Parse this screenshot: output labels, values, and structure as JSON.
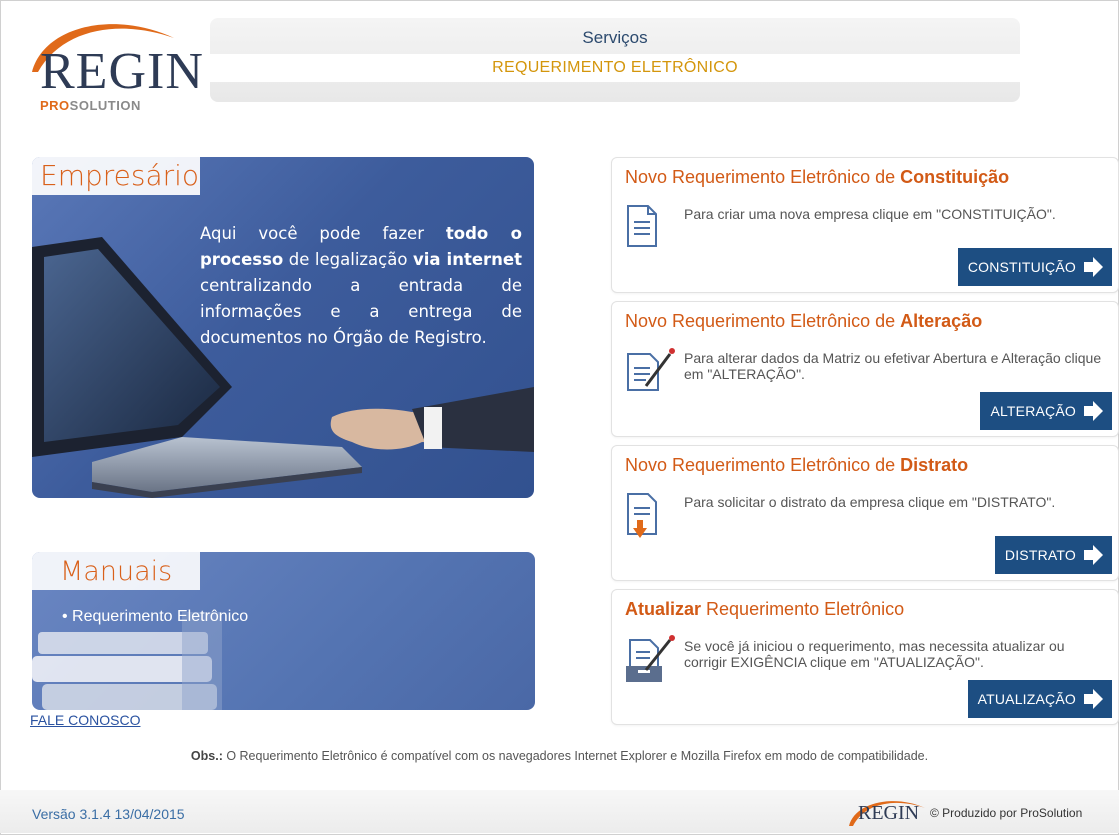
{
  "logo": {
    "name": "REGIN",
    "sub_pro": "PRO",
    "sub_solution": "SOLUTION"
  },
  "header": {
    "title": "Serviços",
    "subtitle": "REQUERIMENTO ELETRÔNICO"
  },
  "empresario": {
    "title": "Empresário",
    "text_1": "Aqui você pode fazer ",
    "text_b1": "todo o processo",
    "text_2": " de legalização ",
    "text_b2": "via internet",
    "text_3": " centralizando a entrada de informações e a entrega de documentos no Órgão de Registro."
  },
  "manuais": {
    "title": "Manuais",
    "link": "• Requerimento Eletrônico"
  },
  "fale_conosco": "FALE CONOSCO",
  "cards": [
    {
      "title_pre": "Novo Requerimento Eletrônico de ",
      "title_bold": "Constituição",
      "title_post": "",
      "desc": "Para criar uma nova empresa clique em \"CONSTITUIÇÃO\".",
      "button": "CONSTITUIÇÃO",
      "icon": "document-icon"
    },
    {
      "title_pre": "Novo Requerimento Eletrônico de ",
      "title_bold": "Alteração",
      "title_post": "",
      "desc": "Para alterar dados da Matriz ou efetivar Abertura e Alteração clique em \"ALTERAÇÃO\".",
      "button": "ALTERAÇÃO",
      "icon": "edit-document-icon"
    },
    {
      "title_pre": "Novo Requerimento Eletrônico de ",
      "title_bold": "Distrato",
      "title_post": "",
      "desc": "Para solicitar o distrato da empresa clique em \"DISTRATO\".",
      "button": "DISTRATO",
      "icon": "document-download-icon"
    },
    {
      "title_pre": "",
      "title_bold": "Atualizar",
      "title_post": " Requerimento Eletrônico",
      "desc": "Se você já iniciou o requerimento, mas necessita atualizar ou corrigir EXIGÊNCIA clique em \"ATUALIZAÇÃO\".",
      "button": "ATUALIZAÇÃO",
      "icon": "update-document-icon"
    }
  ],
  "obs": {
    "label": "Obs.:",
    "text": " O Requerimento Eletrônico é compatível com os navegadores Internet Explorer e Mozilla Firefox em modo de compatibilidade."
  },
  "footer": {
    "version": "Versão 3.1.4 13/04/2015",
    "logo": "REGIN",
    "credit": "© Produzido por ProSolution"
  },
  "colors": {
    "accent": "#d25a16",
    "button": "#1d4e82",
    "panel": "#3d5c9c",
    "header_sub": "#d4960c"
  }
}
